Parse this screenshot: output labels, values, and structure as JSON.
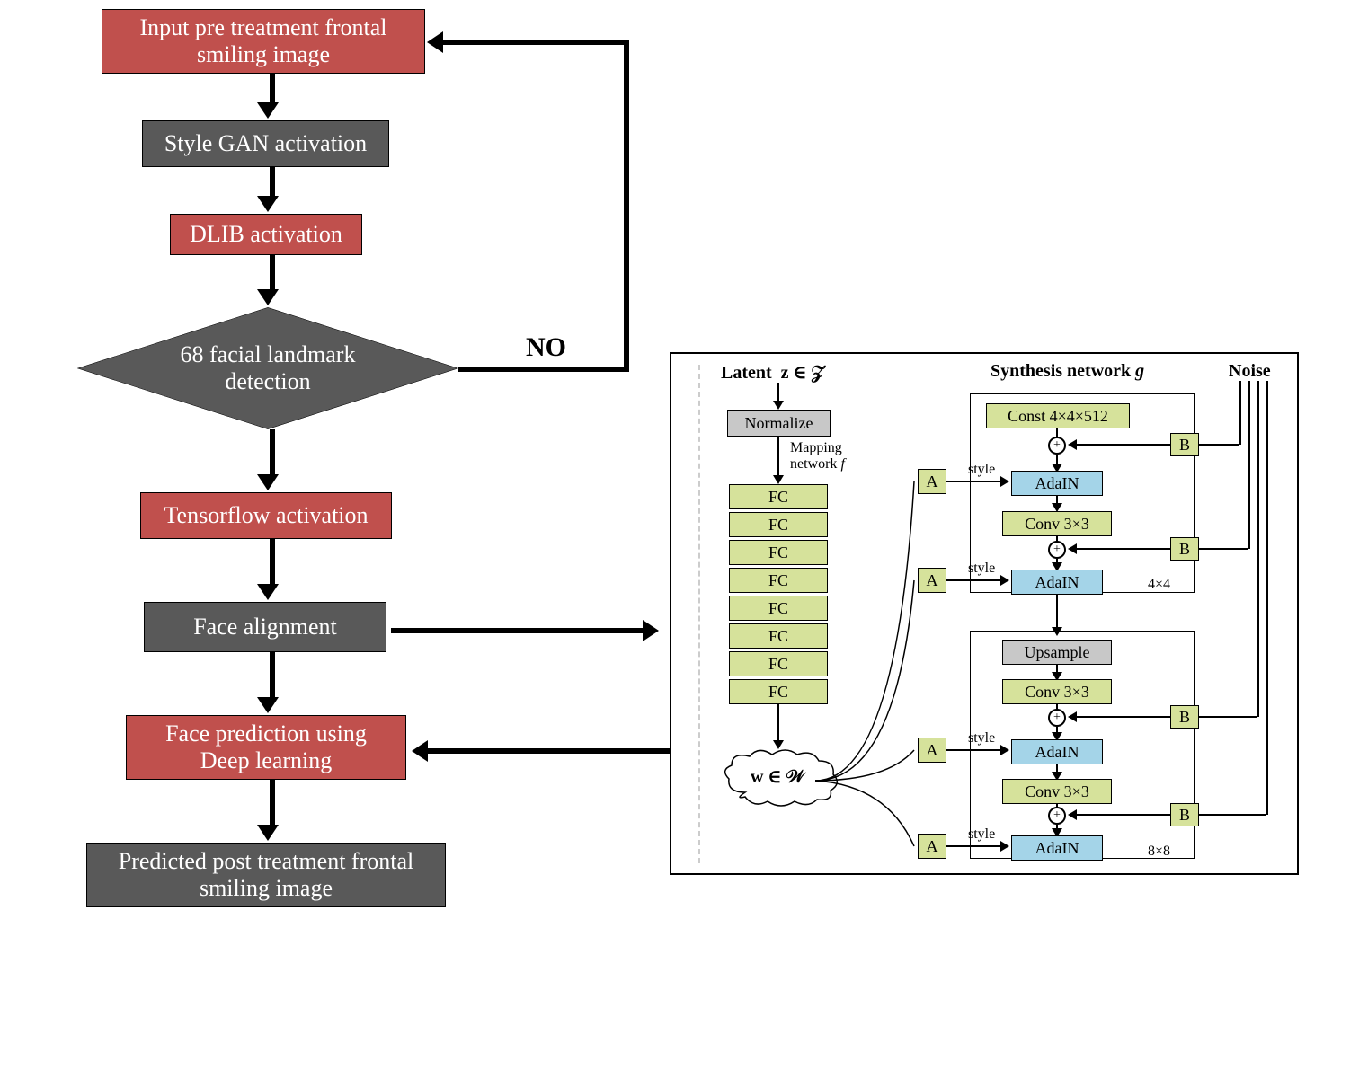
{
  "flowchart": {
    "input": "Input pre treatment frontal\nsmiling image",
    "stylegan": "Style GAN activation",
    "dlib": "DLIB activation",
    "landmark": "68 facial landmark\ndetection",
    "tensorflow": "Tensorflow activation",
    "alignment": "Face alignment",
    "prediction": "Face prediction using\nDeep learning",
    "output": "Predicted post treatment frontal\nsmiling image",
    "no_label": "NO"
  },
  "network": {
    "latent_label": "Latent",
    "latent_z": "z ∈ 𝒵",
    "synthesis_label": "Synthesis network",
    "synthesis_g": "g",
    "noise_label": "Noise",
    "normalize": "Normalize",
    "mapping_label": "Mapping\nnetwork",
    "mapping_f": "f",
    "fc": "FC",
    "const": "Const 4×4×512",
    "adain": "AdaIN",
    "conv": "Conv 3×3",
    "upsample": "Upsample",
    "style_label": "style",
    "a_label": "A",
    "b_label": "B",
    "w_label": "w ∈ 𝒲",
    "size_4x4": "4×4",
    "size_8x8": "8×8"
  },
  "colors": {
    "red": "#c0504d",
    "gray": "#595959",
    "green": "#d6e29b",
    "lightgray": "#c8c8c8",
    "blue": "#a4d4e8"
  }
}
